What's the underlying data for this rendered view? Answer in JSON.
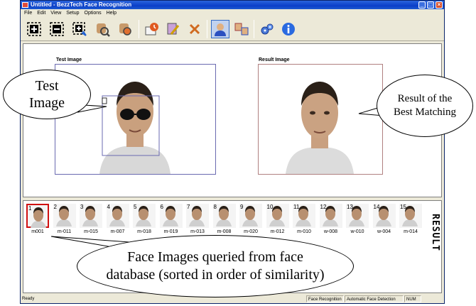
{
  "window": {
    "title": "Untitled - BezzTech Face Recognition",
    "controls": [
      "minimize-icon",
      "maximize-icon",
      "close-icon"
    ]
  },
  "menu": [
    "File",
    "Edit",
    "View",
    "Setup",
    "Options",
    "Help"
  ],
  "toolbar": {
    "buttons": [
      "add-face-icon",
      "remove-face-icon",
      "replace-face-icon",
      "zoom-face-icon",
      "enroll-face-icon",
      "report-icon",
      "settings-brush-icon",
      "delete-icon",
      "recognize-face-icon",
      "compare-faces-icon",
      "configure-gears-icon",
      "info-icon"
    ]
  },
  "main": {
    "test_title": "Test Image",
    "result_title": "Result Image"
  },
  "results": {
    "side_label": "RESULT",
    "thumbs": [
      {
        "n": "1",
        "label": "m001"
      },
      {
        "n": "2",
        "label": "m-011"
      },
      {
        "n": "3",
        "label": "m-015"
      },
      {
        "n": "4",
        "label": "m-007"
      },
      {
        "n": "5",
        "label": "m-018"
      },
      {
        "n": "6",
        "label": "m-019"
      },
      {
        "n": "7",
        "label": "m-013"
      },
      {
        "n": "8",
        "label": "m-008"
      },
      {
        "n": "9",
        "label": "m-020"
      },
      {
        "n": "10",
        "label": "m-012"
      },
      {
        "n": "11",
        "label": "m-010"
      },
      {
        "n": "12",
        "label": "w-008"
      },
      {
        "n": "13",
        "label": "w-010"
      },
      {
        "n": "14",
        "label": "w-004"
      },
      {
        "n": "15",
        "label": "m-014"
      }
    ]
  },
  "status": {
    "ready": "Ready",
    "mode": "Face Recognition",
    "detection": "Automatic Face Detection",
    "num": "NUM"
  },
  "callouts": {
    "test": "Test Image",
    "result": "Result of the Best Matching",
    "query": "Face Images queried from face database (sorted in order of similarity)"
  },
  "colors": {
    "titlebar": "#0a3ec8",
    "best_match_border": "#d01010",
    "window_bg": "#ece9d8"
  }
}
